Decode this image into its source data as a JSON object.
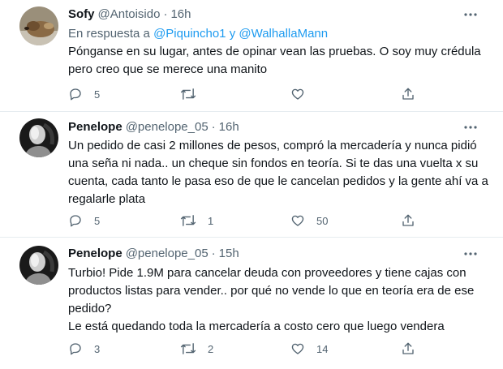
{
  "tweets": [
    {
      "name": "Sofy",
      "handle": "@Antoisido",
      "dot": "·",
      "time": "16h",
      "reply_prefix": "En respuesta a",
      "reply_user1": "@Piquincho1",
      "reply_and": "y",
      "reply_user2": "@WalhallaMann",
      "text": "Pónganse en su lugar, antes de opinar vean las pruebas. O soy muy crédula pero creo que se merece una manito",
      "reply_count": "5",
      "retweet_count": "",
      "like_count": "",
      "avatar_icon": "dog-avatar"
    },
    {
      "name": "Penelope",
      "handle": "@penelope_05",
      "dot": "·",
      "time": "16h",
      "text": "Un pedido de casi 2 millones de pesos, compró la mercadería y nunca pidió una seña ni nada.. un cheque sin fondos en teoría. Si te das una vuelta x su cuenta, cada tanto le pasa eso de que le cancelan pedidos y la gente ahí va a regalarle plata",
      "reply_count": "5",
      "retweet_count": "1",
      "like_count": "50",
      "avatar_icon": "dark-portrait-avatar"
    },
    {
      "name": "Penelope",
      "handle": "@penelope_05",
      "dot": "·",
      "time": "15h",
      "text_line1": "Turbio! Pide 1.9M para cancelar deuda con proveedores y tiene cajas con productos listas para vender.. por qué no vende lo que en teoría era de ese pedido?",
      "text_line2": "Le está quedando toda la mercadería a costo cero que luego vendera",
      "reply_count": "3",
      "retweet_count": "2",
      "like_count": "14",
      "avatar_icon": "dark-portrait-avatar"
    }
  ],
  "icons": {
    "more": "more-icon",
    "reply": "reply-icon",
    "retweet": "retweet-icon",
    "like": "like-icon",
    "share": "share-icon"
  },
  "colors": {
    "link": "#1d9bf0",
    "secondary": "#536471",
    "text": "#0f1419",
    "separator": "#e6ecf0"
  }
}
